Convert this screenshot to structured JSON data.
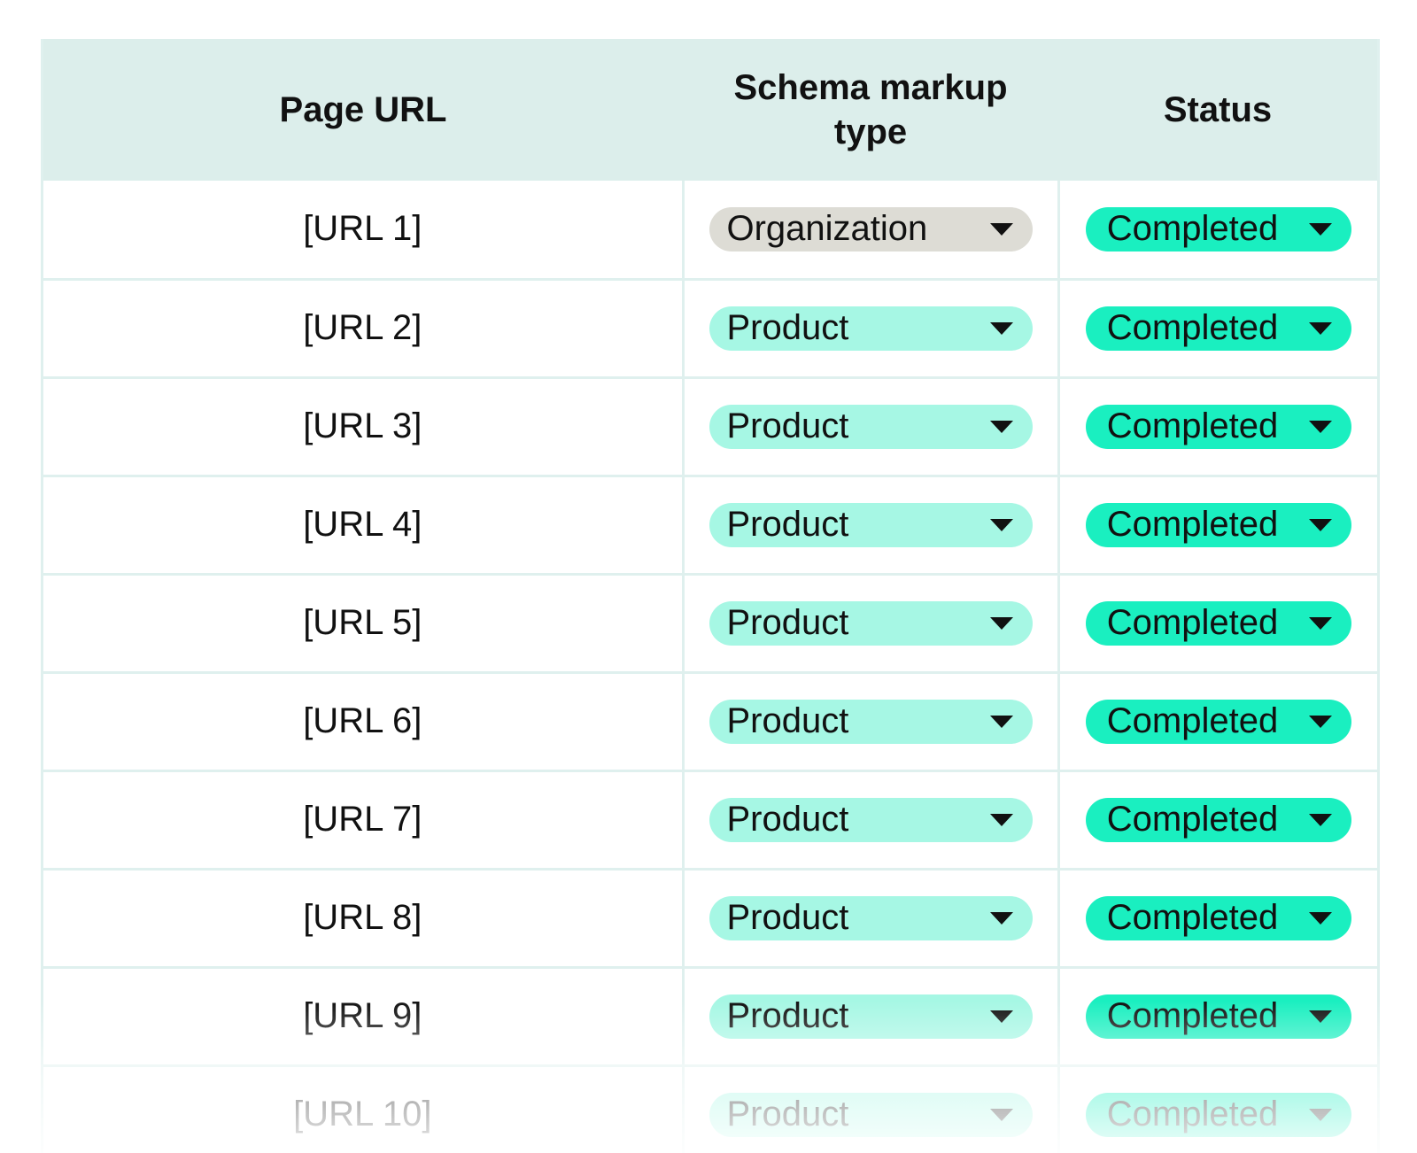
{
  "table": {
    "headers": {
      "url": "Page URL",
      "type": "Schema markup type",
      "status": "Status"
    },
    "rows": [
      {
        "url": "[URL 1]",
        "type": "Organization",
        "status": "Completed"
      },
      {
        "url": "[URL 2]",
        "type": "Product",
        "status": "Completed"
      },
      {
        "url": "[URL 3]",
        "type": "Product",
        "status": "Completed"
      },
      {
        "url": "[URL 4]",
        "type": "Product",
        "status": "Completed"
      },
      {
        "url": "[URL 5]",
        "type": "Product",
        "status": "Completed"
      },
      {
        "url": "[URL 6]",
        "type": "Product",
        "status": "Completed"
      },
      {
        "url": "[URL 7]",
        "type": "Product",
        "status": "Completed"
      },
      {
        "url": "[URL 8]",
        "type": "Product",
        "status": "Completed"
      },
      {
        "url": "[URL 9]",
        "type": "Product",
        "status": "Completed"
      },
      {
        "url": "[URL 10]",
        "type": "Product",
        "status": "Completed"
      }
    ]
  },
  "colors": {
    "header_bg": "#dceeeb",
    "type_chip_product": "#a6f7e4",
    "type_chip_organization": "#dddcd5",
    "status_chip_completed": "#1aefc0",
    "grid_line": "#dff0ee"
  },
  "icons": {
    "dropdown": "chevron-down-icon"
  }
}
